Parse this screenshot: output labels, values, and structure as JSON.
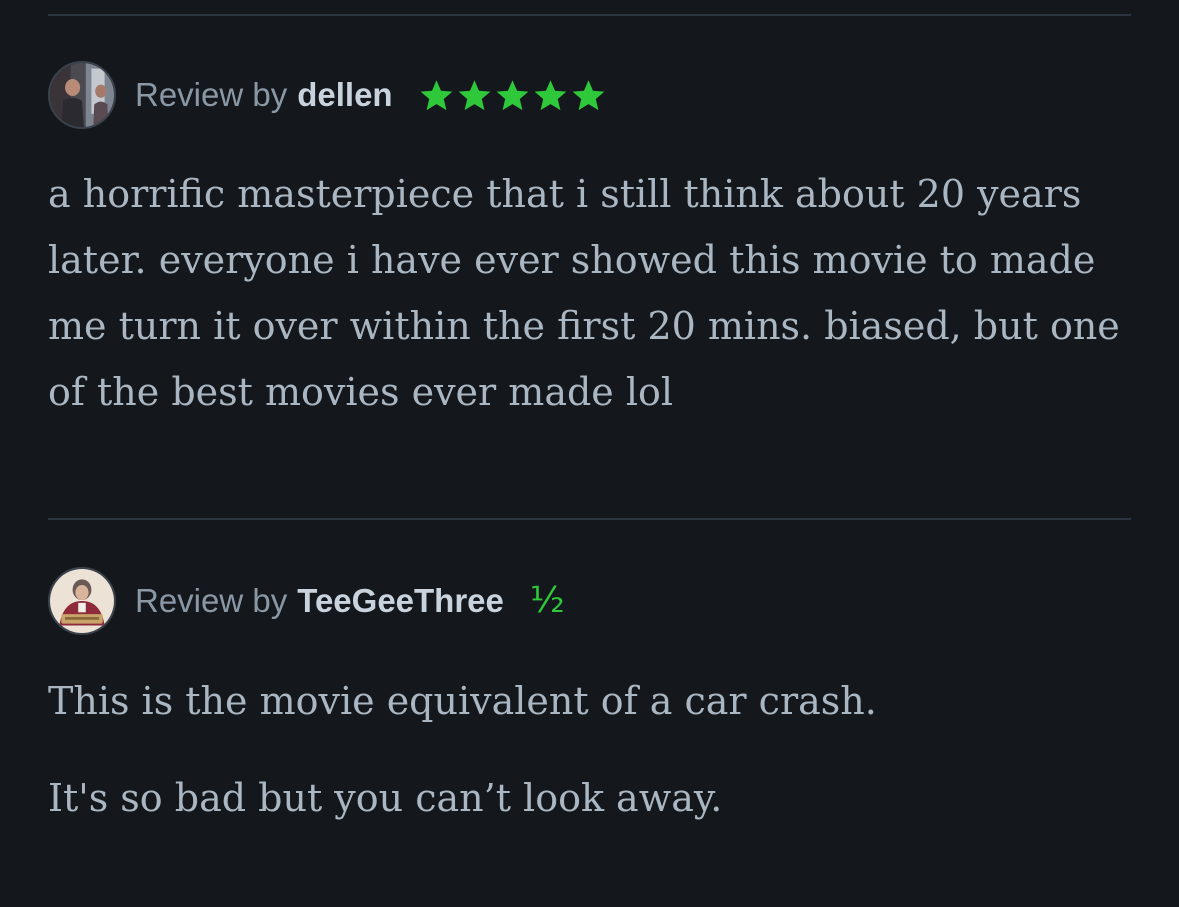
{
  "reviews": [
    {
      "prefix": "Review by",
      "author": "dellen",
      "rating": 5,
      "rating_text": "★★★★★",
      "avatar": "avatar-photo",
      "body": [
        "a horrific masterpiece that i still think about 20 years later. everyone i have ever showed this movie to made me turn it over within the first 20 mins. biased, but one of the best movies ever made lol"
      ]
    },
    {
      "prefix": "Review by",
      "author": "TeeGeeThree",
      "rating": 0.5,
      "rating_text": "½",
      "avatar": "avatar-photo",
      "body": [
        "This is the movie equivalent of a car crash.",
        "It's so bad but you can’t look away."
      ]
    }
  ],
  "colors": {
    "background": "#14181c",
    "divider": "#2c3440",
    "star": "#2fc83a",
    "meta_text": "#8a98a6",
    "author_text": "#c9d3dd",
    "body_text": "#aab6c2"
  },
  "icons": {
    "star": "star-icon",
    "half_star": "half-star-glyph"
  }
}
